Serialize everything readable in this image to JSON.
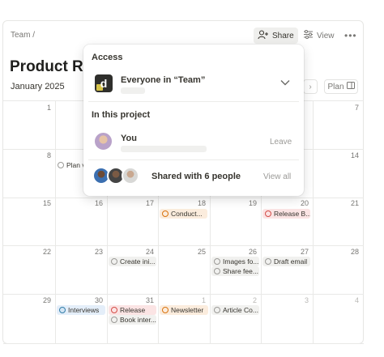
{
  "header": {
    "breadcrumb": "Team /",
    "share_label": "Share",
    "view_label": "View",
    "more_label": "•••"
  },
  "page": {
    "title": "Product Ro",
    "month": "January 2025",
    "next_arrow": "›",
    "plan_label": "Plan"
  },
  "calendar": {
    "day_numbers": [
      "1",
      "7",
      "8",
      "14",
      "15",
      "16",
      "17",
      "18",
      "19",
      "20",
      "21",
      "22",
      "23",
      "24",
      "25",
      "26",
      "27",
      "28",
      "29",
      "30",
      "31",
      "1",
      "2",
      "3",
      "4"
    ],
    "events": [
      {
        "label": "Plan v",
        "color": "grey"
      },
      {
        "label": "Conduct...",
        "color": "orange"
      },
      {
        "label": "Release B...",
        "color": "red"
      },
      {
        "label": "Create ini...",
        "color": "grey"
      },
      {
        "label": "Images fo...",
        "color": "grey"
      },
      {
        "label": "Draft email",
        "color": "grey"
      },
      {
        "label": "Share fee...",
        "color": "grey"
      },
      {
        "label": "Interviews",
        "color": "blue"
      },
      {
        "label": "Release",
        "color": "red"
      },
      {
        "label": "Book inter...",
        "color": "grey"
      },
      {
        "label": "Newsletter",
        "color": "orange"
      },
      {
        "label": "Article Co...",
        "color": "grey"
      }
    ]
  },
  "popover": {
    "access_heading": "Access",
    "workspace_icon_letter": "d",
    "workspace_access": "Everyone in “Team”",
    "project_heading": "In this project",
    "you_label": "You",
    "leave_label": "Leave",
    "shared_label": "Shared with 6 people",
    "view_all_label": "View all"
  },
  "icons": {
    "share": "person-plus-icon",
    "view": "sliders-icon",
    "more": "more-icon",
    "chevron": "chevron-down-icon",
    "plan": "sidebar-icon"
  }
}
